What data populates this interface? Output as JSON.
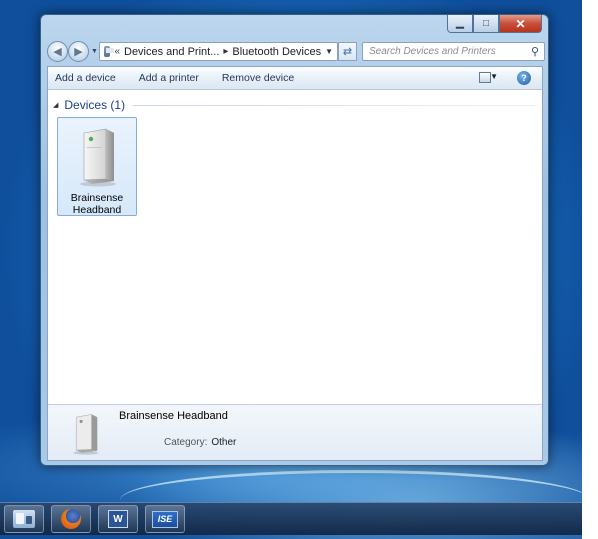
{
  "window": {
    "caption": {
      "minimize_glyph": "▁",
      "maximize_glyph": "□",
      "close_glyph": "✕"
    },
    "address": {
      "overflow_glyph": "«",
      "parts": [
        "Devices and Print...",
        "Bluetooth Devices"
      ],
      "separator_glyph": "▸"
    },
    "search": {
      "placeholder": "Search Devices and Printers"
    },
    "command_bar": {
      "add_device": "Add a device",
      "add_printer": "Add a printer",
      "remove_device": "Remove device",
      "help_glyph": "?"
    },
    "group": {
      "title": "Devices (1)"
    },
    "devices": [
      {
        "name_line1": "Brainsense",
        "name_line2": "Headband"
      }
    ],
    "details": {
      "name": "Brainsense Headband",
      "category_label": "Category:",
      "category_value": "Other"
    }
  },
  "taskbar": {
    "items": [
      {
        "icon": "devices-and-printers-icon"
      },
      {
        "icon": "firefox-icon"
      },
      {
        "icon": "word-icon",
        "glyph": "W"
      },
      {
        "icon": "ise-icon",
        "glyph": "ISE"
      }
    ]
  },
  "colors": {
    "accent": "#1e3d8f",
    "selection": "#d6e8fa",
    "close_button": "#c7503a"
  }
}
